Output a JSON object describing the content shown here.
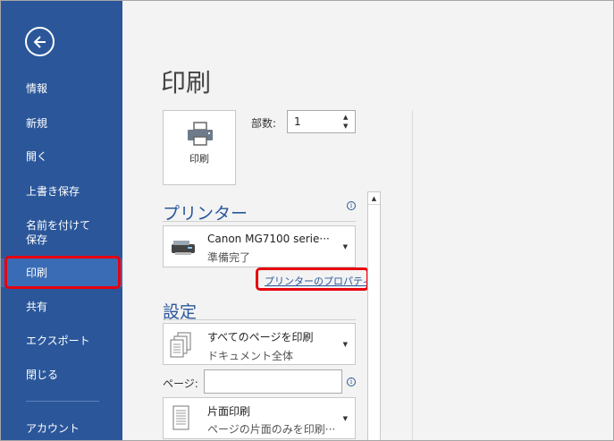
{
  "sidebar": {
    "items": [
      {
        "label": "情報"
      },
      {
        "label": "新規"
      },
      {
        "label": "開く"
      },
      {
        "label": "上書き保存"
      },
      {
        "label": "名前を付けて\n保存"
      },
      {
        "label": "印刷"
      },
      {
        "label": "共有"
      },
      {
        "label": "エクスポート"
      },
      {
        "label": "閉じる"
      },
      {
        "label": "アカウント"
      }
    ],
    "active_item": "印刷",
    "back_icon": "back-arrow-icon"
  },
  "main": {
    "title": "印刷",
    "print_button_label": "印刷",
    "copies_label": "部数:",
    "copies_value": "1",
    "printer_heading": "プリンター",
    "printer_name": "Canon MG7100 serie···",
    "printer_status": "準備完了",
    "printer_properties_link": "プリンターのプロパティ",
    "settings_heading": "設定",
    "print_scope_title": "すべてのページを印刷",
    "print_scope_sub": "ドキュメント全体",
    "pages_label": "ページ:",
    "pages_value": "",
    "sides_title": "片面印刷",
    "sides_sub": "ページの片面のみを印刷···"
  },
  "colors": {
    "sidebar_bg": "#2b579a",
    "accent": "#2b579a",
    "highlight_border": "#e8000d"
  }
}
